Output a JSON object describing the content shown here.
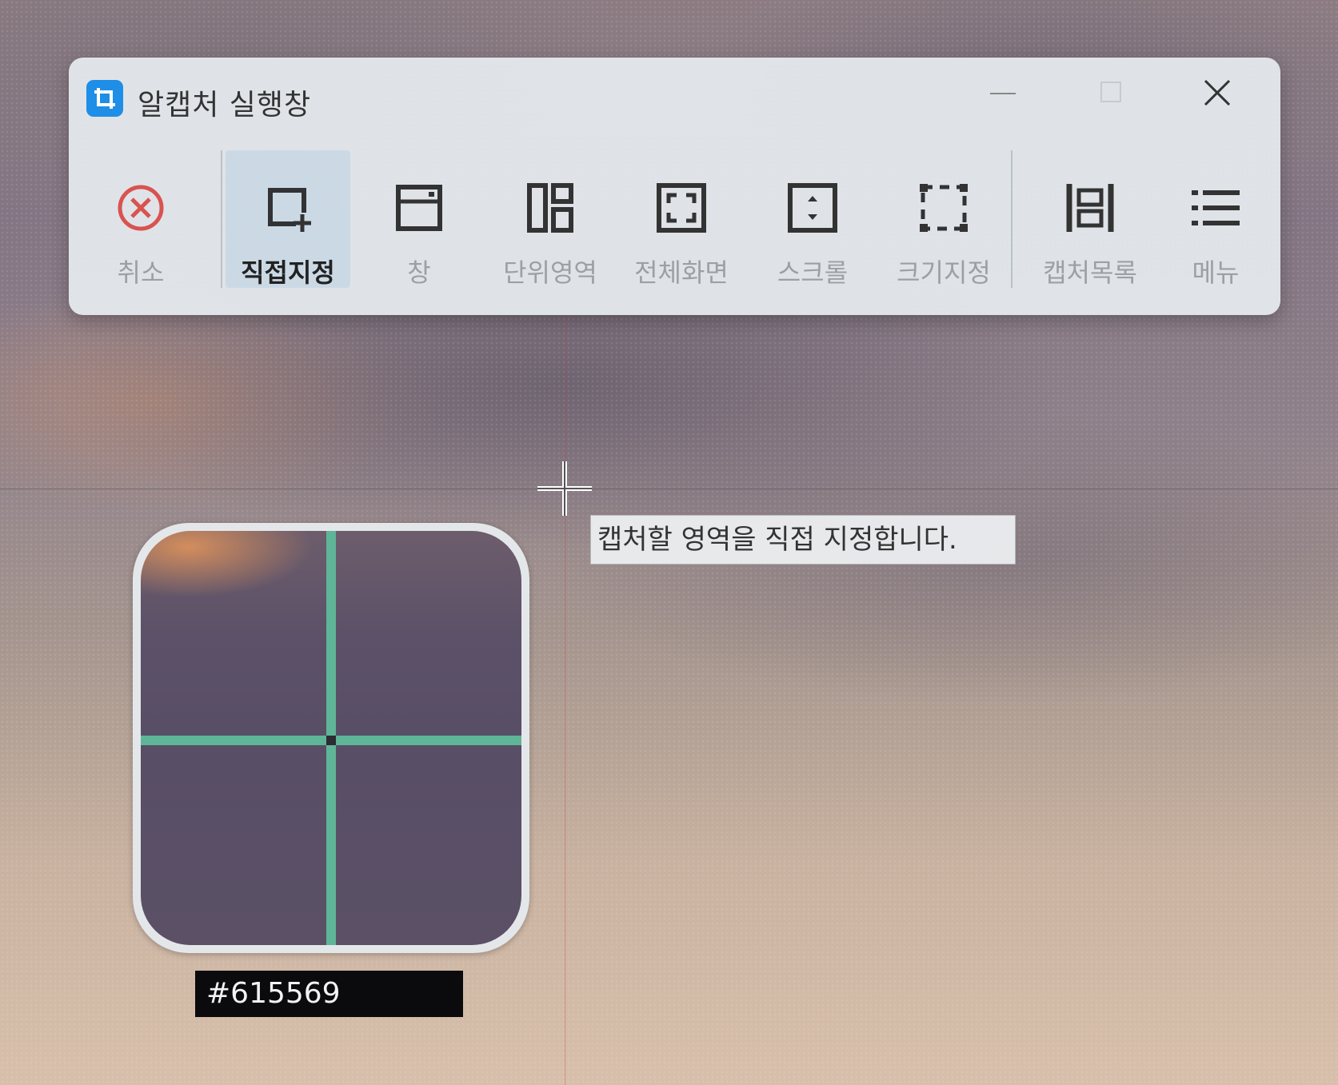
{
  "window": {
    "title": "알캡처 실행창",
    "icon": "crop-icon",
    "controls": [
      "minimize-icon",
      "maximize-icon",
      "close-icon"
    ]
  },
  "toolbar": {
    "cancel_label": "취소",
    "tools": [
      {
        "label": "직접지정",
        "icon": "region-add-icon",
        "active": true
      },
      {
        "label": "창",
        "icon": "window-icon",
        "active": false
      },
      {
        "label": "단위영역",
        "icon": "unit-area-icon",
        "active": false
      },
      {
        "label": "전체화면",
        "icon": "fullscreen-icon",
        "active": false
      },
      {
        "label": "스크롤",
        "icon": "scroll-icon",
        "active": false
      },
      {
        "label": "크기지정",
        "icon": "fixed-size-icon",
        "active": false
      },
      {
        "label": "캡처목록",
        "icon": "capture-list-icon",
        "active": false
      },
      {
        "label": "메뉴",
        "icon": "menu-icon",
        "active": false
      }
    ]
  },
  "tooltip": "캡처할 영역을 직접 지정합니다.",
  "magnifier": {
    "pixel_color": "#615569",
    "crosshair_color": "#5fb597"
  },
  "colors": {
    "cancel_red": "#d9534f",
    "app_icon_blue": "#1e8ee6"
  }
}
